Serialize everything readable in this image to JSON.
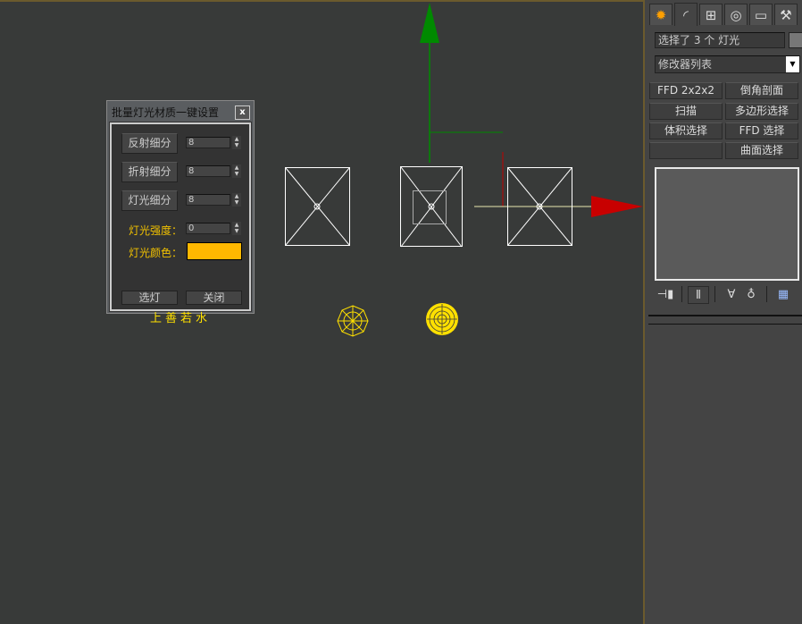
{
  "dialog": {
    "title": "批量灯光材质一键设置",
    "close_label": "x",
    "reflect_button": "反射细分",
    "reflect_value": "8",
    "refract_button": "折射细分",
    "refract_value": "8",
    "light_subdiv_button": "灯光细分",
    "light_subdiv_value": "8",
    "intensity_label": "灯光强度：",
    "intensity_value": "0",
    "color_label": "灯光颜色：",
    "color_value": "#ffb800",
    "select_lights_button": "选灯",
    "close_button": "关闭",
    "signature": "上善若水"
  },
  "panel": {
    "tabs": [
      "create-icon",
      "modify-icon",
      "hierarchy-icon",
      "motion-icon",
      "display-icon",
      "utilities-icon"
    ],
    "selection_text": "选择了 3 个 灯光",
    "modifier_list": "修改器列表",
    "modifier_buttons": [
      "FFD 2x2x2",
      "倒角剖面",
      "扫描",
      "多边形选择",
      "体积选择",
      "FFD 选择",
      "",
      "曲面选择"
    ]
  },
  "colors": {
    "accent": "#6b5a2d",
    "y_axis": "#008a00",
    "x_axis": "#c80000",
    "lights": "#ffe000"
  }
}
